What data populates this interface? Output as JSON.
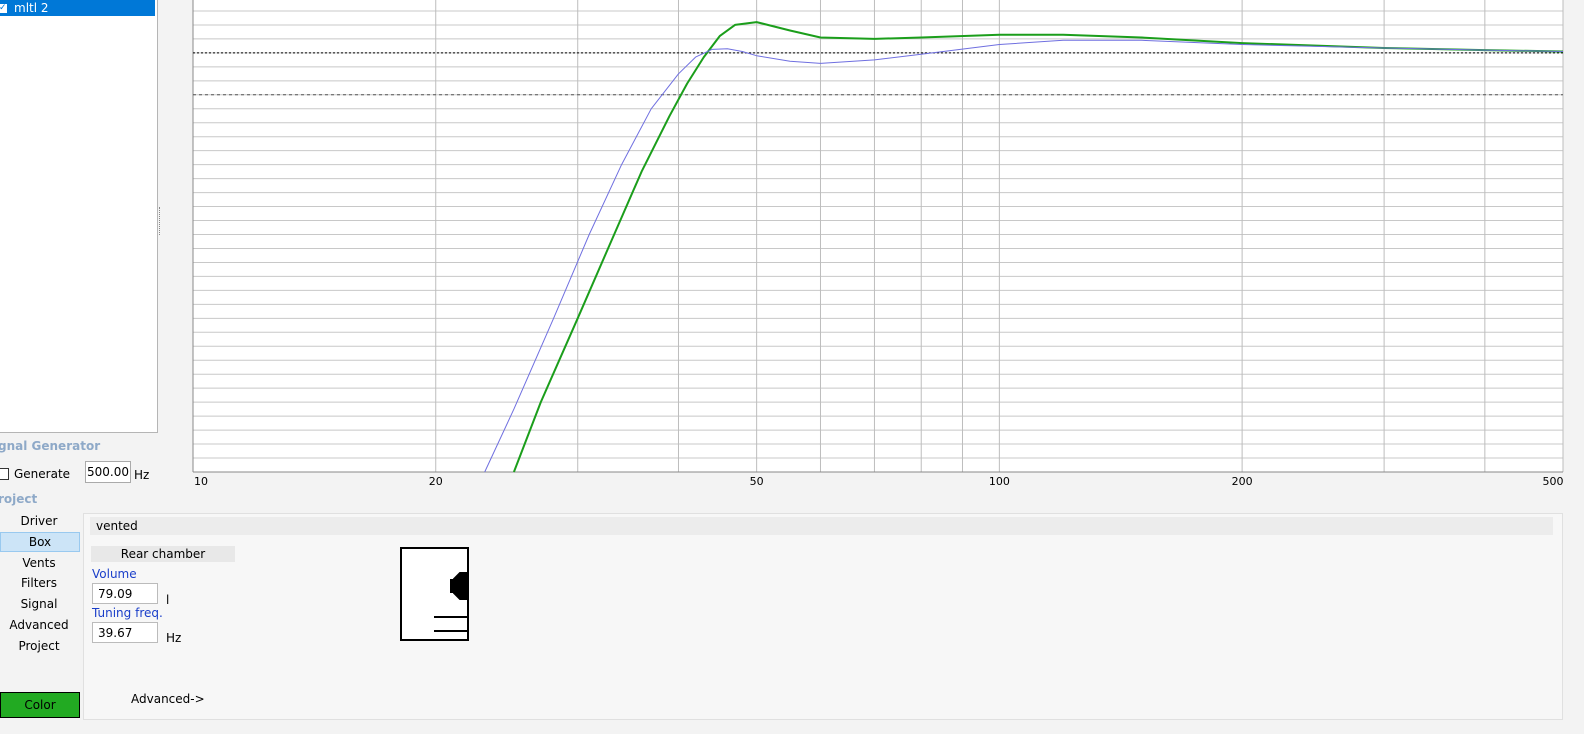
{
  "project_list": {
    "items": [
      {
        "label": "mltl 2",
        "checked": true
      }
    ]
  },
  "signal_generator": {
    "title": "gnal Generator",
    "generate_label": "Generate",
    "generate_checked": false,
    "frequency": "500.00",
    "frequency_unit": "Hz"
  },
  "project_section": {
    "title": "roject"
  },
  "nav": {
    "items": [
      {
        "label": "Driver",
        "active": false
      },
      {
        "label": "Box",
        "active": true
      },
      {
        "label": "Vents",
        "active": false
      },
      {
        "label": "Filters",
        "active": false
      },
      {
        "label": "Signal",
        "active": false
      },
      {
        "label": "Advanced",
        "active": false
      },
      {
        "label": "Project",
        "active": false
      }
    ],
    "color_button": "Color",
    "color_value": "#22aa22"
  },
  "box_panel": {
    "type": "vented",
    "rear_chamber_header": "Rear chamber",
    "volume_label": "Volume",
    "volume_value": "79.09",
    "volume_unit": "l",
    "tuning_label": "Tuning freq.",
    "tuning_value": "39.67",
    "tuning_unit": "Hz",
    "advanced_button": "Advanced->"
  },
  "chart_data": {
    "type": "line",
    "xscale": "log",
    "xlim": [
      10,
      500
    ],
    "ylim": [
      -30,
      4
    ],
    "x_tick_labels": [
      "10",
      "20",
      "50",
      "100",
      "200",
      "500"
    ],
    "x_ticks": [
      10,
      20,
      50,
      100,
      200,
      500
    ],
    "x_minor_ticks": [
      30,
      40,
      60,
      70,
      80,
      90,
      300,
      400
    ],
    "y_ticks": [
      4,
      3,
      2,
      1,
      0,
      -1,
      -2,
      -3,
      -4,
      -5,
      -6,
      -7,
      -8,
      -9,
      -10,
      -11,
      -12,
      -13,
      -14,
      -15,
      -16,
      -17,
      -18,
      -19,
      -20,
      -21,
      -22,
      -23,
      -24,
      -25,
      -26,
      -27,
      -28,
      -29
    ],
    "reference_lines": [
      {
        "y": 0,
        "style": "dotted",
        "color": "#000000"
      },
      {
        "y": -3,
        "style": "dashed",
        "color": "#555555"
      }
    ],
    "grid": true,
    "series": [
      {
        "color": "#1b9e1b",
        "width": 2,
        "x": [
          25,
          27,
          30,
          33,
          36,
          39,
          41,
          43,
          45,
          47,
          50,
          55,
          60,
          70,
          80,
          100,
          120,
          150,
          200,
          300,
          400,
          500
        ],
        "y": [
          -30,
          -25,
          -19,
          -13.5,
          -8.5,
          -4.5,
          -2.2,
          -0.3,
          1.2,
          2.0,
          2.2,
          1.6,
          1.1,
          1.0,
          1.1,
          1.3,
          1.3,
          1.1,
          0.7,
          0.35,
          0.2,
          0.1
        ]
      },
      {
        "color": "#6f6fe0",
        "width": 1,
        "x": [
          23,
          25,
          28,
          31,
          34,
          37,
          40,
          42,
          44,
          46,
          48,
          50,
          55,
          60,
          70,
          80,
          100,
          120,
          150,
          200,
          300,
          400,
          500
        ],
        "y": [
          -30,
          -25.5,
          -19,
          -13,
          -8,
          -4,
          -1.5,
          -0.3,
          0.25,
          0.3,
          0.1,
          -0.2,
          -0.6,
          -0.75,
          -0.5,
          -0.1,
          0.6,
          0.9,
          0.9,
          0.6,
          0.35,
          0.2,
          0.1
        ]
      }
    ]
  }
}
